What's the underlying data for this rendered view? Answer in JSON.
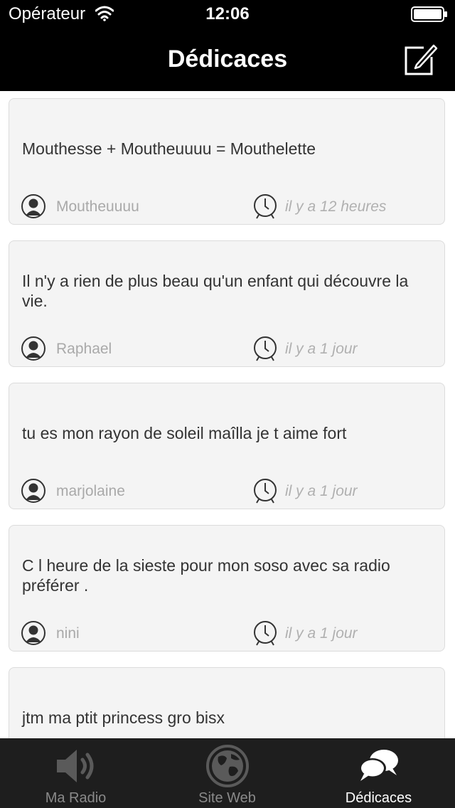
{
  "status_bar": {
    "carrier": "Opérateur",
    "time": "12:06"
  },
  "nav": {
    "title": "Dédicaces",
    "compose_icon": "compose-icon"
  },
  "cards": [
    {
      "message": "Mouthesse + Moutheuuuu = Mouthelette",
      "author": "Moutheuuuu",
      "time": "il y a 12 heures"
    },
    {
      "message": "Il n'y a rien de plus beau qu'un enfant qui découvre la vie.",
      "author": "Raphael",
      "time": "il y a 1 jour"
    },
    {
      "message": "tu es mon rayon de soleil maîlla je t aime fort",
      "author": "marjolaine",
      "time": "il y a 1 jour"
    },
    {
      "message": "C l heure de la sieste pour mon soso avec sa radio préférer .",
      "author": "nini",
      "time": "il y a 1 jour"
    },
    {
      "message": "jtm ma ptit princess gro bisx",
      "author": "",
      "time": ""
    }
  ],
  "tabs": [
    {
      "label": "Ma Radio",
      "icon": "speaker-icon",
      "active": false
    },
    {
      "label": "Site Web",
      "icon": "globe-icon",
      "active": false
    },
    {
      "label": "Dédicaces",
      "icon": "chat-bubbles-icon",
      "active": true
    }
  ],
  "colors": {
    "bar_background": "#000000",
    "tab_bar_background": "#1e1e1e",
    "card_background": "#f4f4f4",
    "muted_text": "#a9a9a9"
  }
}
